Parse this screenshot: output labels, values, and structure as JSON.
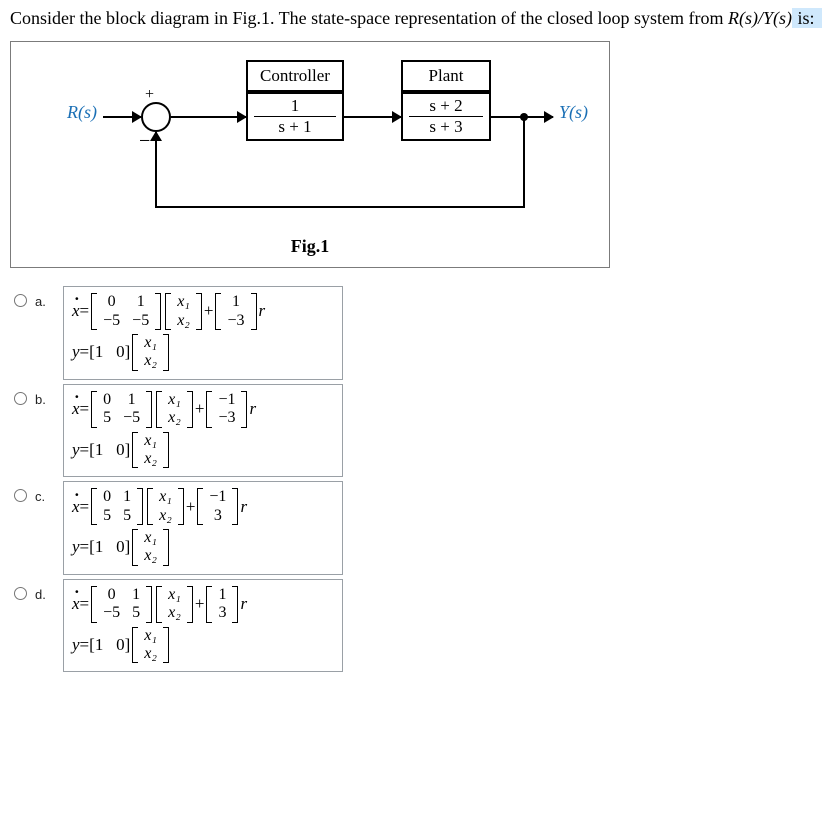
{
  "question": {
    "prefix": "Consider the block diagram in Fig.1. The state-space representation of the closed loop system from ",
    "ratio": "R(s)/Y(s)",
    "suffix": " is:"
  },
  "diagram": {
    "input_label": "R(s)",
    "output_label": "Y(s)",
    "controller_title": "Controller",
    "controller_num": "1",
    "controller_den": "s + 1",
    "plant_title": "Plant",
    "plant_num": "s + 2",
    "plant_den": "s + 3",
    "plus": "+",
    "minus": "−",
    "caption": "Fig.1"
  },
  "options": {
    "a": {
      "label": "a.",
      "A": [
        [
          "0",
          "1"
        ],
        [
          "−5",
          "−5"
        ]
      ],
      "B": [
        [
          "1"
        ],
        [
          "−3"
        ]
      ],
      "C": [
        "1",
        "0"
      ]
    },
    "b": {
      "label": "b.",
      "A": [
        [
          "0",
          "1"
        ],
        [
          "5",
          "−5"
        ]
      ],
      "B": [
        [
          "−1"
        ],
        [
          "−3"
        ]
      ],
      "C": [
        "1",
        "0"
      ]
    },
    "c": {
      "label": "c.",
      "A": [
        [
          "0",
          "1"
        ],
        [
          "5",
          "5"
        ]
      ],
      "B": [
        [
          "−1"
        ],
        [
          "3"
        ]
      ],
      "C": [
        "1",
        "0"
      ]
    },
    "d": {
      "label": "d.",
      "A": [
        [
          "0",
          "1"
        ],
        [
          "−5",
          "5"
        ]
      ],
      "B": [
        [
          "1"
        ],
        [
          "3"
        ]
      ],
      "C": [
        "1",
        "0"
      ]
    }
  },
  "sym": {
    "xdot": "x",
    "eq": " = ",
    "plus": " + ",
    "r": "r",
    "y": "y",
    "x1": "x₁",
    "x2": "x₂"
  }
}
